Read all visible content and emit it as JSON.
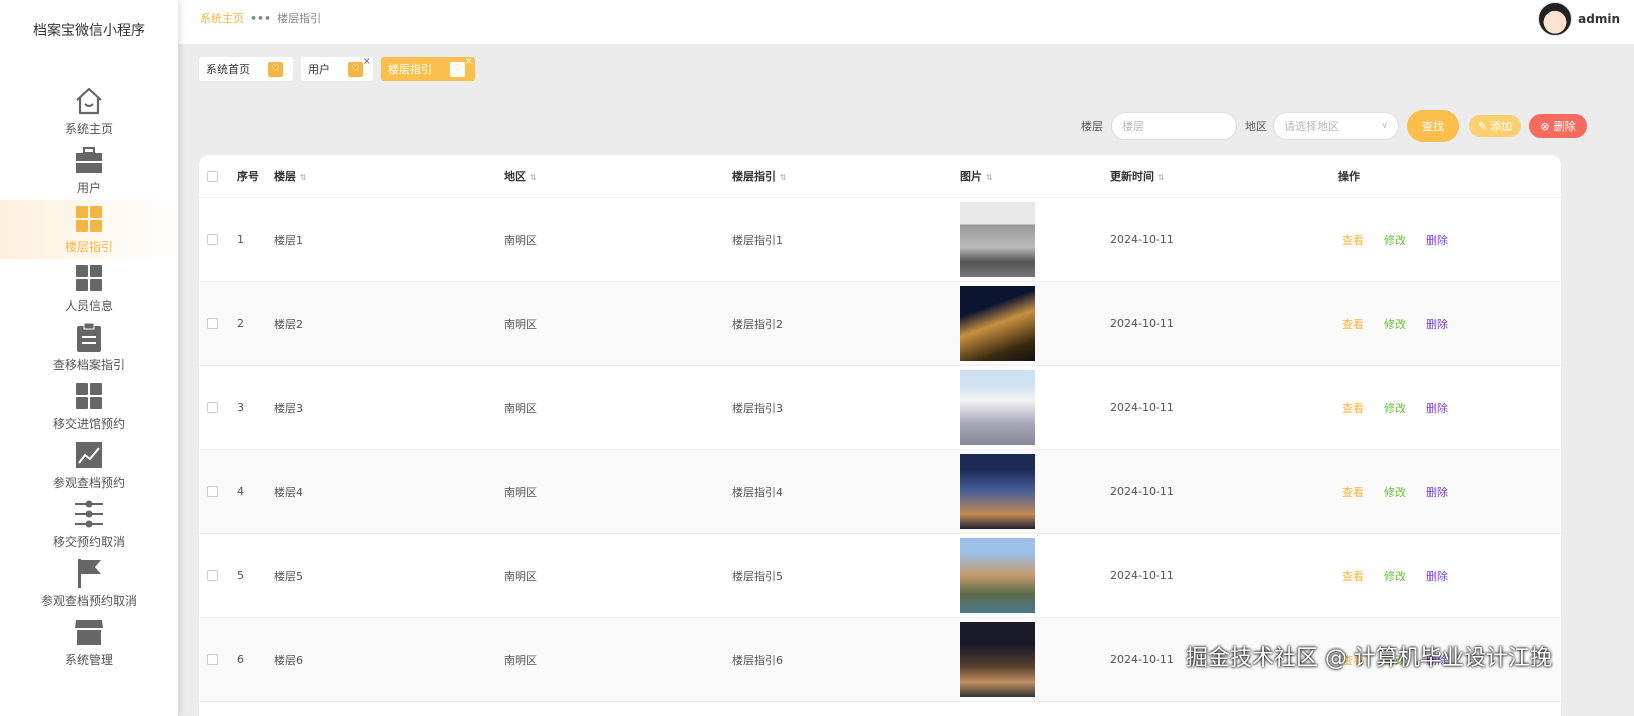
{
  "app_title": "档案宝微信小程序",
  "sidebar": {
    "items": [
      {
        "label": "系统主页",
        "icon": "home-icon"
      },
      {
        "label": "用户",
        "icon": "briefcase-icon"
      },
      {
        "label": "楼层指引",
        "icon": "grid-icon",
        "active": true
      },
      {
        "label": "人员信息",
        "icon": "grid-icon"
      },
      {
        "label": "查移档案指引",
        "icon": "clipboard-icon"
      },
      {
        "label": "移交进馆预约",
        "icon": "grid-icon"
      },
      {
        "label": "参观查档预约",
        "icon": "chart-icon"
      },
      {
        "label": "移交预约取消",
        "icon": "sliders-icon"
      },
      {
        "label": "参观查档预约取消",
        "icon": "flag-icon"
      },
      {
        "label": "系统管理",
        "icon": "store-icon"
      }
    ]
  },
  "breadcrumb": {
    "home": "系统主页",
    "current": "楼层指引"
  },
  "user": {
    "name": "admin"
  },
  "tabs": [
    {
      "label": "系统首页"
    },
    {
      "label": "用户"
    },
    {
      "label": "楼层指引"
    }
  ],
  "search": {
    "floor_label": "楼层",
    "floor_placeholder": "楼层",
    "region_label": "地区",
    "region_placeholder": "请选择地区",
    "search_btn": "查找",
    "add_btn": "添加",
    "delete_btn": "删除"
  },
  "table": {
    "headers": [
      "序号",
      "楼层",
      "地区",
      "楼层指引",
      "图片",
      "更新时间",
      "操作"
    ],
    "actions": {
      "view": "查看",
      "edit": "修改",
      "delete": "删除"
    },
    "rows": [
      {
        "no": "1",
        "floor": "楼层1",
        "region": "南明区",
        "guide": "楼层指引1",
        "date": "2024-10-11"
      },
      {
        "no": "2",
        "floor": "楼层2",
        "region": "南明区",
        "guide": "楼层指引2",
        "date": "2024-10-11"
      },
      {
        "no": "3",
        "floor": "楼层3",
        "region": "南明区",
        "guide": "楼层指引3",
        "date": "2024-10-11"
      },
      {
        "no": "4",
        "floor": "楼层4",
        "region": "南明区",
        "guide": "楼层指引4",
        "date": "2024-10-11"
      },
      {
        "no": "5",
        "floor": "楼层5",
        "region": "南明区",
        "guide": "楼层指引5",
        "date": "2024-10-11"
      },
      {
        "no": "6",
        "floor": "楼层6",
        "region": "南明区",
        "guide": "楼层指引6",
        "date": "2024-10-11"
      }
    ]
  },
  "watermark": "掘金技术社区 @ 计算机毕业设计江挽",
  "colors": {
    "accent": "#f5b544",
    "danger": "#f56c6c",
    "edit": "#67c23a",
    "delete": "#7b3fd0"
  }
}
